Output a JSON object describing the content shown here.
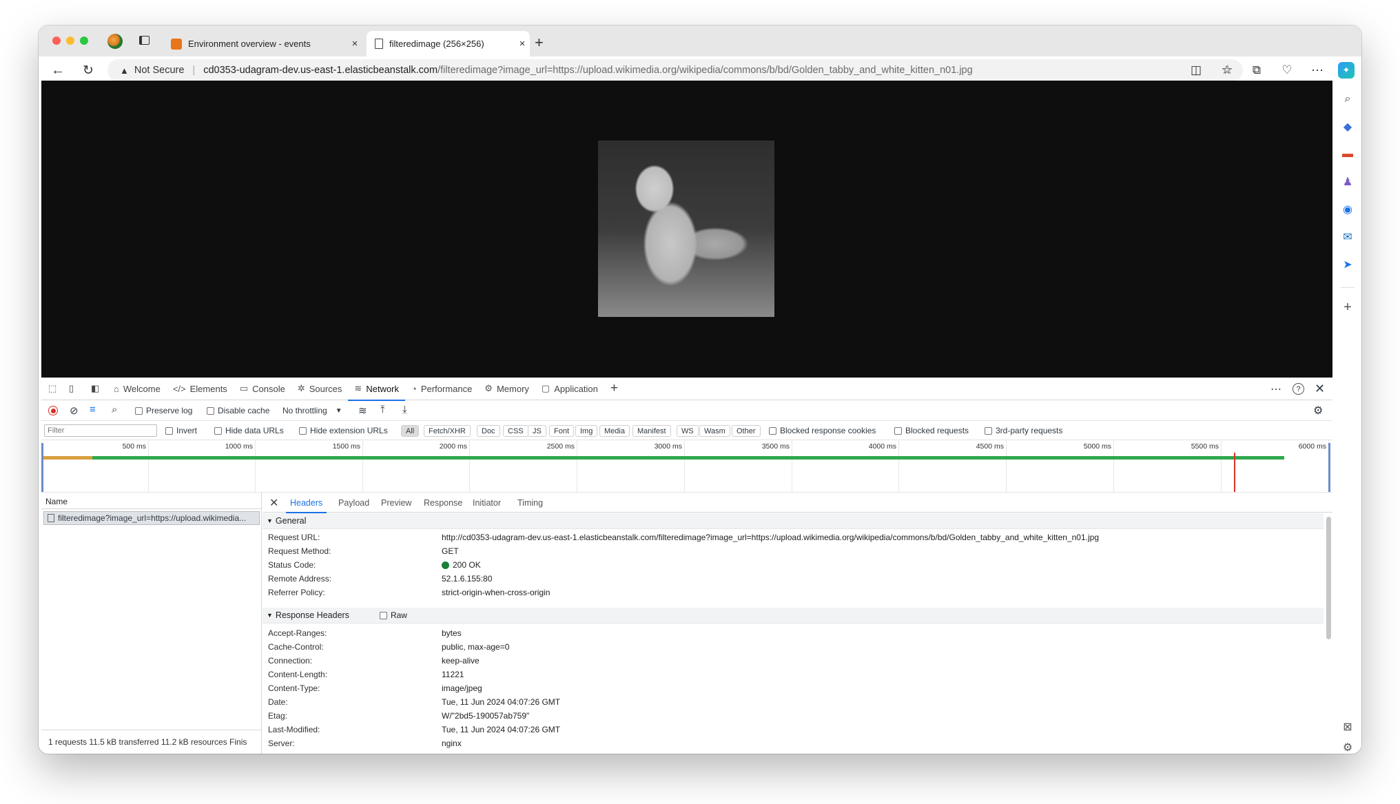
{
  "tabs": [
    {
      "title": "Environment overview - events",
      "close": "×"
    },
    {
      "title": "filteredimage (256×256)",
      "close": "×"
    }
  ],
  "new_tab": "+",
  "address": {
    "security": "Not Secure",
    "host": "cd0353-udagram-dev.us-east-1.elasticbeanstalk.com",
    "path": "/filteredimage?image_url=https://upload.wikimedia.org/wikipedia/commons/b/bd/Golden_tabby_and_white_kitten_n01.jpg"
  },
  "devtools": {
    "tabs": [
      {
        "label": "Welcome",
        "icon": "⌂"
      },
      {
        "label": "Elements",
        "icon": "</>"
      },
      {
        "label": "Console",
        "icon": "▭"
      },
      {
        "label": "Sources",
        "icon": "✲"
      },
      {
        "label": "Network",
        "icon": "≋"
      },
      {
        "label": "Performance",
        "icon": "◔"
      },
      {
        "label": "Memory",
        "icon": "⚙"
      },
      {
        "label": "Application",
        "icon": "▢"
      }
    ],
    "network": {
      "preserve_log": "Preserve log",
      "disable_cache": "Disable cache",
      "throttling": "No throttling",
      "filter_placeholder": "Filter",
      "invert": "Invert",
      "hide_data_urls": "Hide data URLs",
      "hide_extension_urls": "Hide extension URLs",
      "type_filters": [
        "All",
        "Fetch/XHR",
        "Doc",
        "CSS",
        "JS",
        "Font",
        "Img",
        "Media",
        "Manifest",
        "WS",
        "Wasm",
        "Other"
      ],
      "blocked_response_cookies": "Blocked response cookies",
      "blocked_requests": "Blocked requests",
      "third_party": "3rd-party requests",
      "timeline_ticks": [
        "500 ms",
        "1000 ms",
        "1500 ms",
        "2000 ms",
        "2500 ms",
        "3000 ms",
        "3500 ms",
        "4000 ms",
        "4500 ms",
        "5000 ms",
        "5500 ms",
        "6000 ms"
      ],
      "name_header": "Name",
      "request_name": "filteredimage?image_url=https://upload.wikimedia...",
      "status_bar": "1 requests  11.5 kB transferred  11.2 kB resources  Finis"
    },
    "detail_tabs": [
      "Headers",
      "Payload",
      "Preview",
      "Response",
      "Initiator",
      "Timing"
    ],
    "general": {
      "title": "General",
      "rows": [
        {
          "k": "Request URL:",
          "v": "http://cd0353-udagram-dev.us-east-1.elasticbeanstalk.com/filteredimage?image_url=https://upload.wikimedia.org/wikipedia/commons/b/bd/Golden_tabby_and_white_kitten_n01.jpg"
        },
        {
          "k": "Request Method:",
          "v": "GET"
        },
        {
          "k": "Status Code:",
          "v": "200 OK"
        },
        {
          "k": "Remote Address:",
          "v": "52.1.6.155:80"
        },
        {
          "k": "Referrer Policy:",
          "v": "strict-origin-when-cross-origin"
        }
      ]
    },
    "response_headers": {
      "title": "Response Headers",
      "raw": "Raw",
      "rows": [
        {
          "k": "Accept-Ranges:",
          "v": "bytes"
        },
        {
          "k": "Cache-Control:",
          "v": "public, max-age=0"
        },
        {
          "k": "Connection:",
          "v": "keep-alive"
        },
        {
          "k": "Content-Length:",
          "v": "11221"
        },
        {
          "k": "Content-Type:",
          "v": "image/jpeg"
        },
        {
          "k": "Date:",
          "v": "Tue, 11 Jun 2024 04:07:26 GMT"
        },
        {
          "k": "Etag:",
          "v": "W/\"2bd5-190057ab759\""
        },
        {
          "k": "Last-Modified:",
          "v": "Tue, 11 Jun 2024 04:07:26 GMT"
        },
        {
          "k": "Server:",
          "v": "nginx"
        }
      ]
    }
  },
  "colors": {
    "accent": "#1a73e8",
    "status_ok": "#188038",
    "record": "#d93025"
  }
}
